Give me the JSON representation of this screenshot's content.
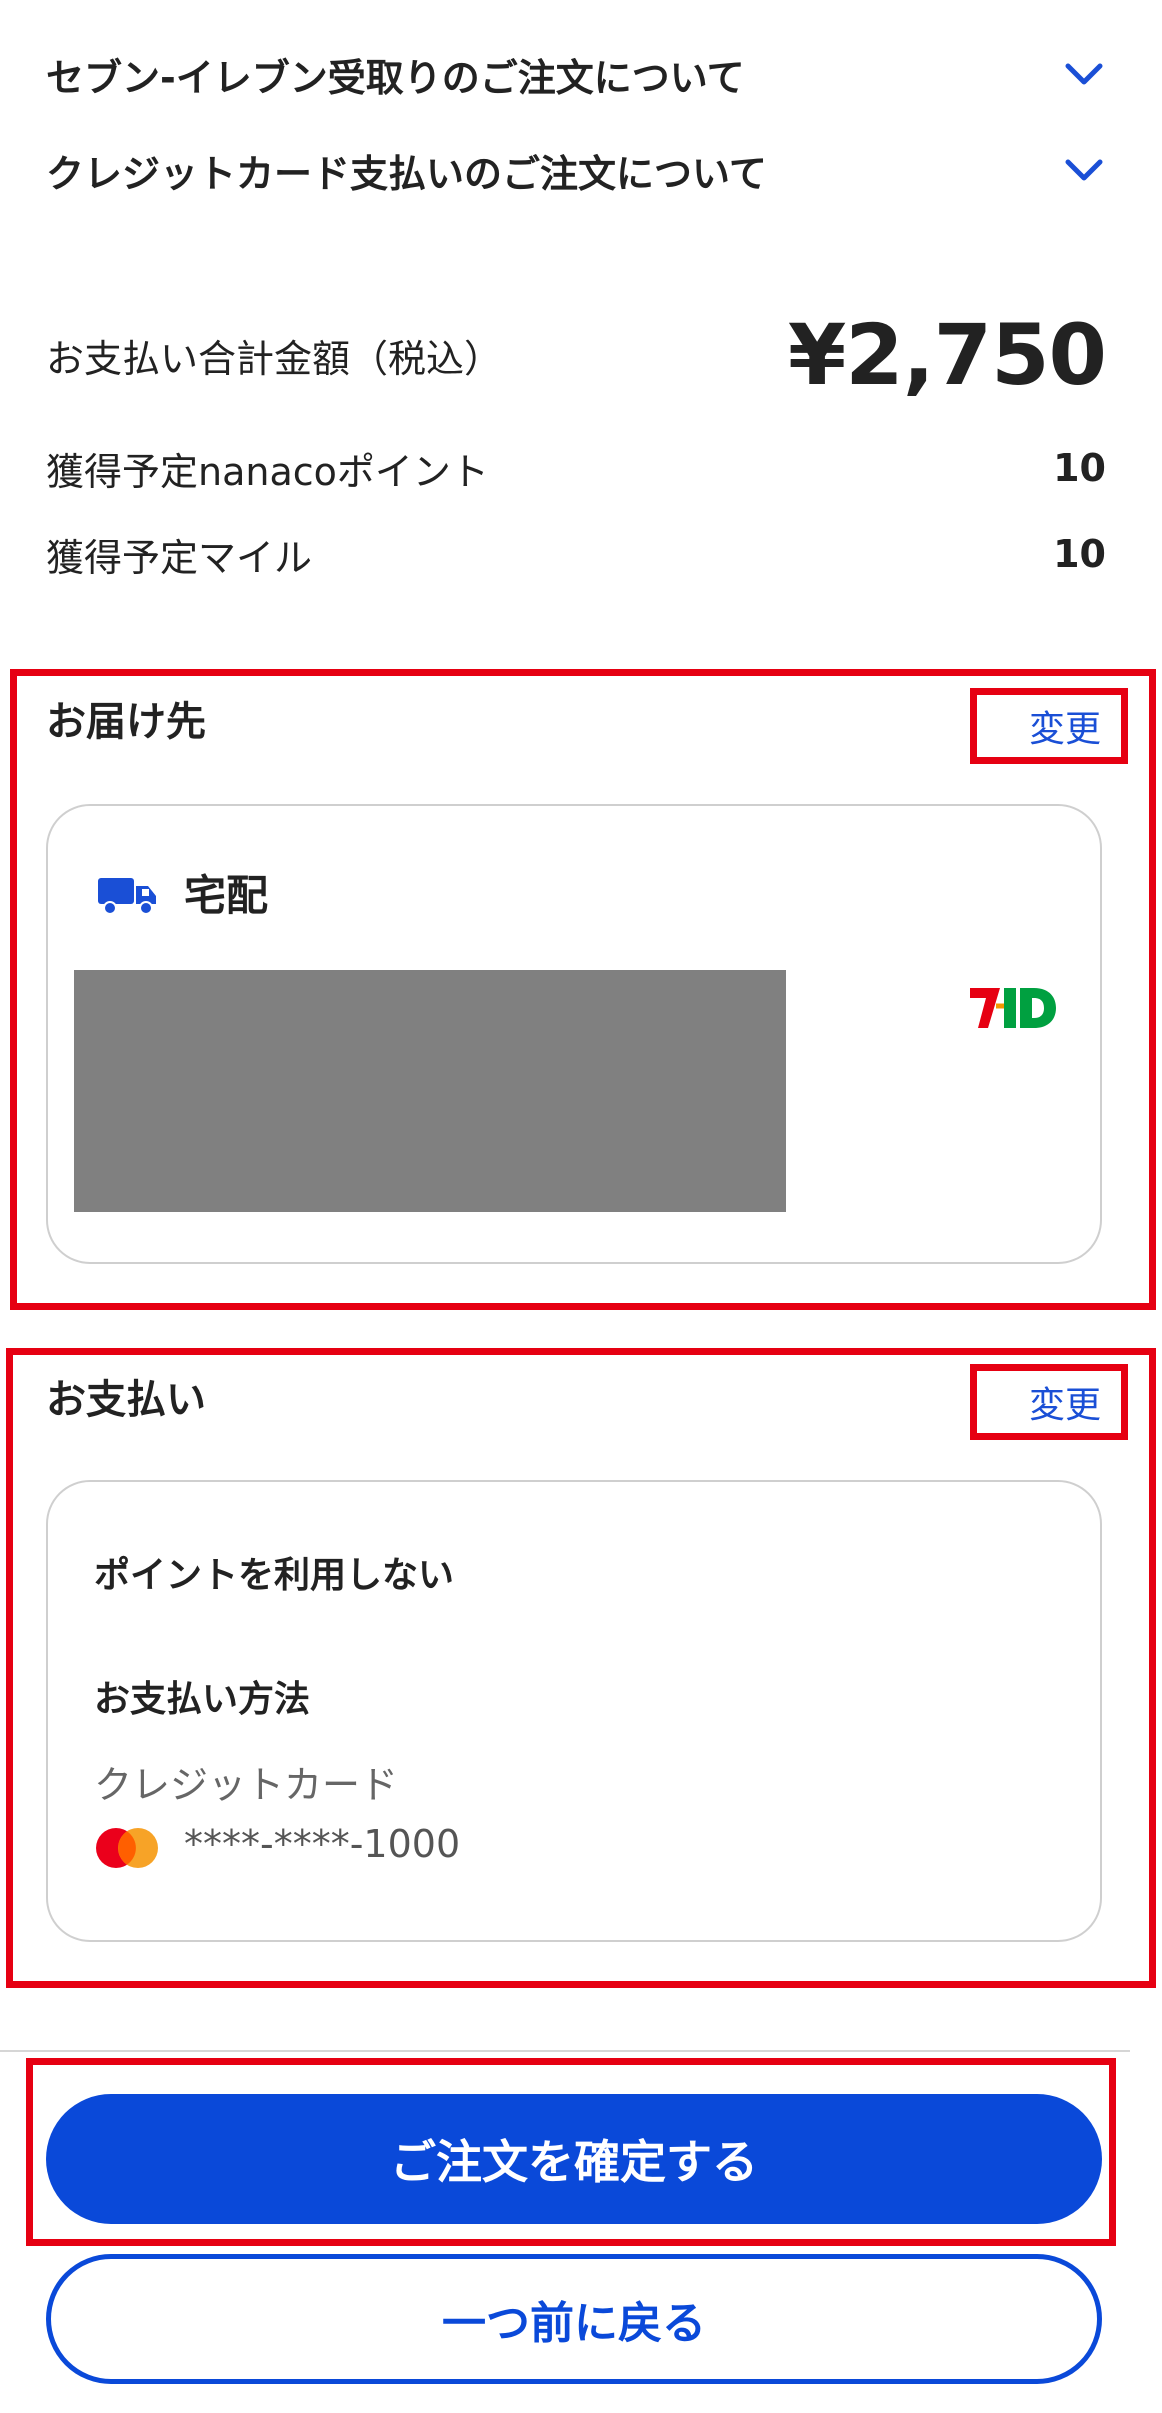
{
  "accordions": [
    {
      "label": "セブン-イレブン受取りのご注文について"
    },
    {
      "label": "クレジットカード支払いのご注文について"
    }
  ],
  "summary": {
    "total_label": "お支払い合計金額（税込）",
    "total_value": "¥2,750",
    "nanaco_label": "獲得予定nanacoポイント",
    "nanaco_value": "10",
    "mile_label": "獲得予定マイル",
    "mile_value": "10"
  },
  "delivery": {
    "title": "お届け先",
    "change_label": "変更",
    "method": "宅配",
    "logo_text": "7iD"
  },
  "payment": {
    "title": "お支払い",
    "change_label": "変更",
    "points": "ポイントを利用しない",
    "method_heading": "お支払い方法",
    "method": "クレジットカード",
    "card_number": "****-****-1000"
  },
  "actions": {
    "confirm_label": "ご注文を確定する",
    "back_label": "一つ前に戻る"
  },
  "colors": {
    "accent": "#0a49d9",
    "highlight": "#e60012",
    "logo_red": "#e60012",
    "logo_green": "#00a040",
    "mastercard_red": "#eb001b",
    "mastercard_orange": "#f79e1b"
  }
}
